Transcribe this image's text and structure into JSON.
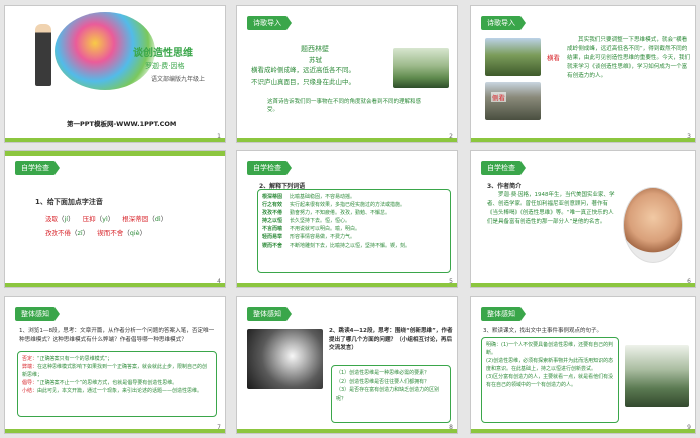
{
  "slides": [
    {
      "num": "1",
      "title": "谈创造性思维",
      "author": "罗迦·费·因格",
      "edition": "语文部编版九年级上",
      "footer": "第一PPT模板网-WWW.1PPT.COM"
    },
    {
      "num": "2",
      "tag": "诗歌导入",
      "poem_title": "题西林壁",
      "poem_author": "苏轼",
      "poem_lines": [
        "横看成岭侧成峰，远近高低各不同。",
        "不识庐山真面目，只缘身在此山中。"
      ],
      "note": "这首诗告诉我们同一事物在不同的角度就会看到不同的理解和感受。"
    },
    {
      "num": "3",
      "tag": "诗歌导入",
      "label_a": "横看",
      "label_b": "侧看",
      "text": "其实我们只要调整一下思维模式，就会“横看成岭侧成峰，远近高低各不同”，得到截然不同的结果，由此可见创造性思维的重要性。今天，我们就来学习《谈创造性思维》，学习如何成为一个富有创造力的人。"
    },
    {
      "num": "4",
      "tag": "自学检查",
      "heading": "1、给下面加点字注音",
      "items": [
        {
          "word": "汲取",
          "pinyin": "jí"
        },
        {
          "word": "压抑",
          "pinyin": "yì"
        },
        {
          "word": "根深蒂固",
          "pinyin": "dì"
        },
        {
          "word": "孜孜不倦",
          "pinyin": "zī"
        },
        {
          "word": "锲而不舍",
          "pinyin": "qiè"
        }
      ]
    },
    {
      "num": "5",
      "tag": "自学检查",
      "heading": "2、解释下列词语",
      "terms": [
        {
          "term": "根深蒂固",
          "def": "比喻基础稳固，不容易动摇。"
        },
        {
          "term": "行之有效",
          "def": "实行起来很有效果，多指已经实施过的方法或措施。"
        },
        {
          "term": "孜孜不倦",
          "def": "勤奋努力，不知疲倦。孜孜，勤勉、不懈怠。"
        },
        {
          "term": "持之以恒",
          "def": "长久坚持下去。恒，恒心。"
        },
        {
          "term": "不言而喻",
          "def": "不用说就可以明白。喻，明白。"
        },
        {
          "term": "轻而易举",
          "def": "形容事情容易做，不费力气。"
        },
        {
          "term": "锲而不舍",
          "def": "不断地雕刻下去，比喻持之以恒，坚持不懈。锲，刻。"
        }
      ]
    },
    {
      "num": "6",
      "tag": "自学检查",
      "heading": "3、作者简介",
      "bio": "罗迦·费·因格，1948年生，当代美国实业家、学者、创造学家。曾任加利福尼亚创意顾问，著作有《当头棒喝》《创造性思维》等。“唯一真正快乐的人们是具备富有创造性的那一部分人”是他的名言。"
    },
    {
      "num": "7",
      "tag": "整体感知",
      "question": "1、浏览1—8段，思考：文章开篇，从作者分析一个问题的答案入笔，否定唯一种思维模式？这种思维模式有什么弊端？作者倡导哪一种思维模式？",
      "answers": [
        {
          "k": "否定：",
          "v": "“正确答案只有一个的思维模式”；"
        },
        {
          "k": "弊端：",
          "v": "在这种思维模式影响下如果找到一个正确答案，就会就此止步，限制自己的创新思维；"
        },
        {
          "k": "倡导：",
          "v": "“正确答案不止一个”的思维方式，也就是倡导要有创造性思维。"
        },
        {
          "k": "小结：",
          "v": "由此可见，本文开篇，通过一个现象，来引出论述的话题——创造性思维。"
        }
      ]
    },
    {
      "num": "8",
      "tag": "整体感知",
      "question": "2、跳读4—12段，思考：围绕“创新思维”，作者提出了哪几个方面的问题？（小组相互讨论，再后交流发言）",
      "answers": [
        "（1）创造性思维是一种思维必需的要素？",
        "（2）创造性思维是否往往要人们都拥有？",
        "（3）是否存在富有创造力和缺乏创造力的区别呢？"
      ]
    },
    {
      "num": "9",
      "tag": "整体感知",
      "question": "3、默读课文，找出文中主事件事例观点的句子。",
      "answers": [
        "明确：(1)一个人不仅要具备创造性思维，还要有自己的判断。",
        "(2)创造性思维，必须有探索新事物并为此而活用知识的态度和意识。在此基础上，持之以恒进行创新尝试。",
        "(3)区分富有创造力的人，主要就看一点，就是看他们有没有在自己的领域中的一个有创造力的人。"
      ]
    }
  ]
}
